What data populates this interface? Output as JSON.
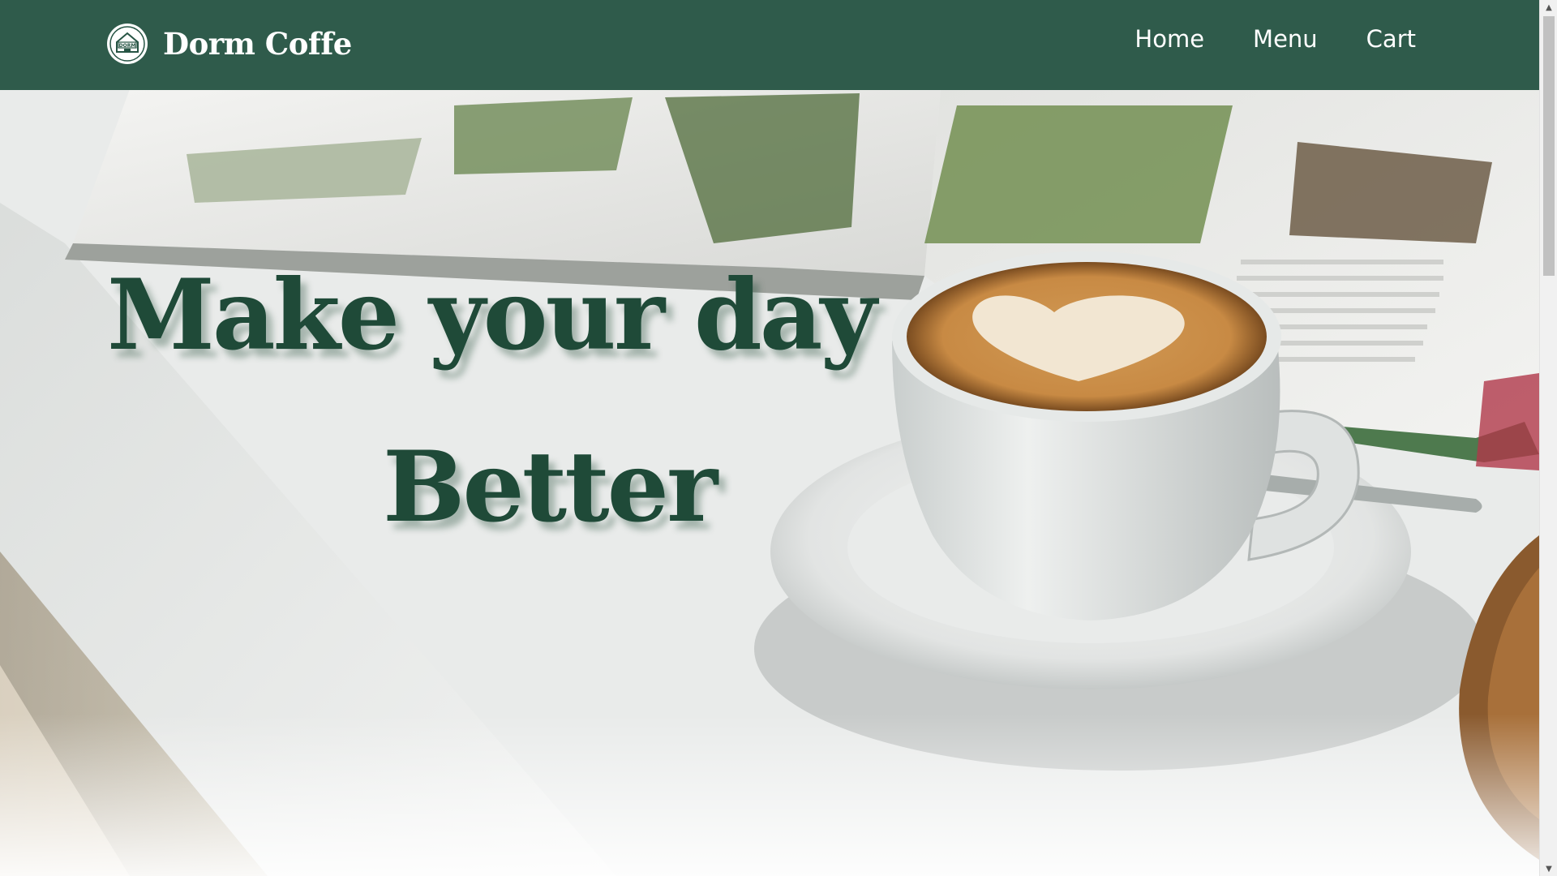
{
  "navbar": {
    "brand_name": "Dorm Coffe",
    "logo_icon": "coffee-badge-icon",
    "logo_text": "DORM",
    "links": [
      {
        "label": "Home"
      },
      {
        "label": "Menu"
      },
      {
        "label": "Cart"
      }
    ],
    "background_color": "#265444"
  },
  "hero": {
    "headline_line_1": "Make your day",
    "headline_line_2": "Better",
    "headline_color": "#1f4a38",
    "image_subject": "latte-art-coffee-cup-with-magazine"
  },
  "scrollbar": {
    "up_icon": "▲",
    "down_icon": "▼"
  }
}
